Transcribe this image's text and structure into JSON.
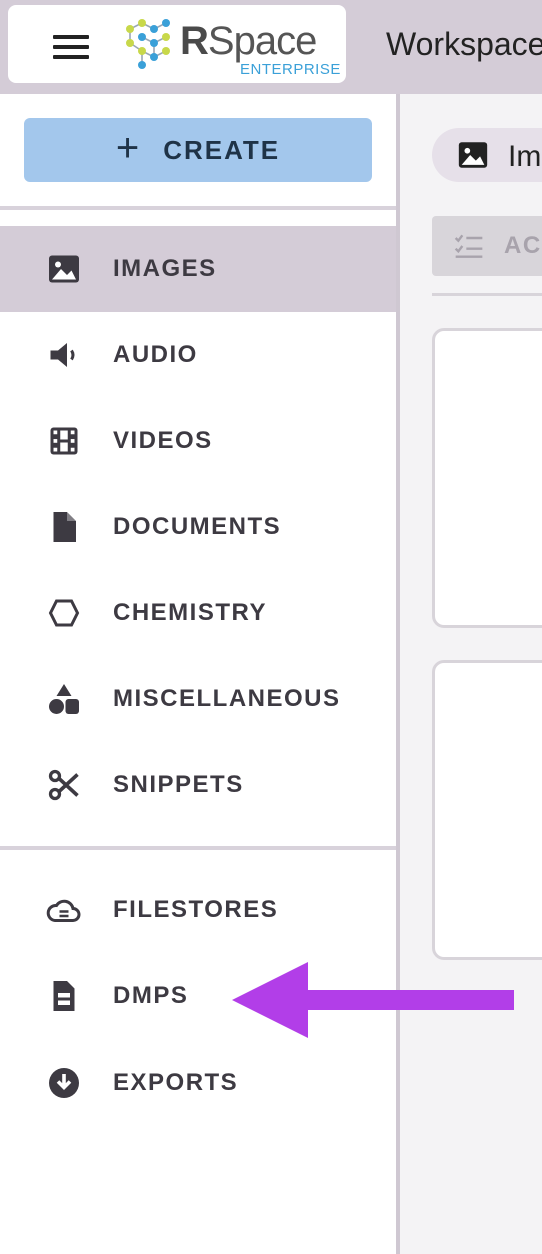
{
  "header": {
    "logo_text_bold": "R",
    "logo_text": "Space",
    "logo_sub": "ENTERPRISE",
    "app_title": "Workspace"
  },
  "sidebar": {
    "create_label": "CREATE",
    "items": [
      {
        "label": "IMAGES",
        "icon": "image-icon",
        "active": true
      },
      {
        "label": "AUDIO",
        "icon": "speaker-icon"
      },
      {
        "label": "VIDEOS",
        "icon": "film-icon"
      },
      {
        "label": "DOCUMENTS",
        "icon": "document-icon"
      },
      {
        "label": "CHEMISTRY",
        "icon": "hexagon-icon"
      },
      {
        "label": "MISCELLANEOUS",
        "icon": "shapes-icon"
      },
      {
        "label": "SNIPPETS",
        "icon": "scissors-icon"
      },
      {
        "label": "FILESTORES",
        "icon": "cloud-storage-icon"
      },
      {
        "label": "DMPS",
        "icon": "dmp-document-icon"
      },
      {
        "label": "EXPORTS",
        "icon": "download-circle-icon"
      }
    ]
  },
  "main": {
    "chip_label": "Im",
    "actions_label": "AC"
  },
  "colors": {
    "accent_create": "#a3c7ec",
    "active_bg": "#d4ccd7",
    "annotation_arrow": "#b23ee8"
  }
}
